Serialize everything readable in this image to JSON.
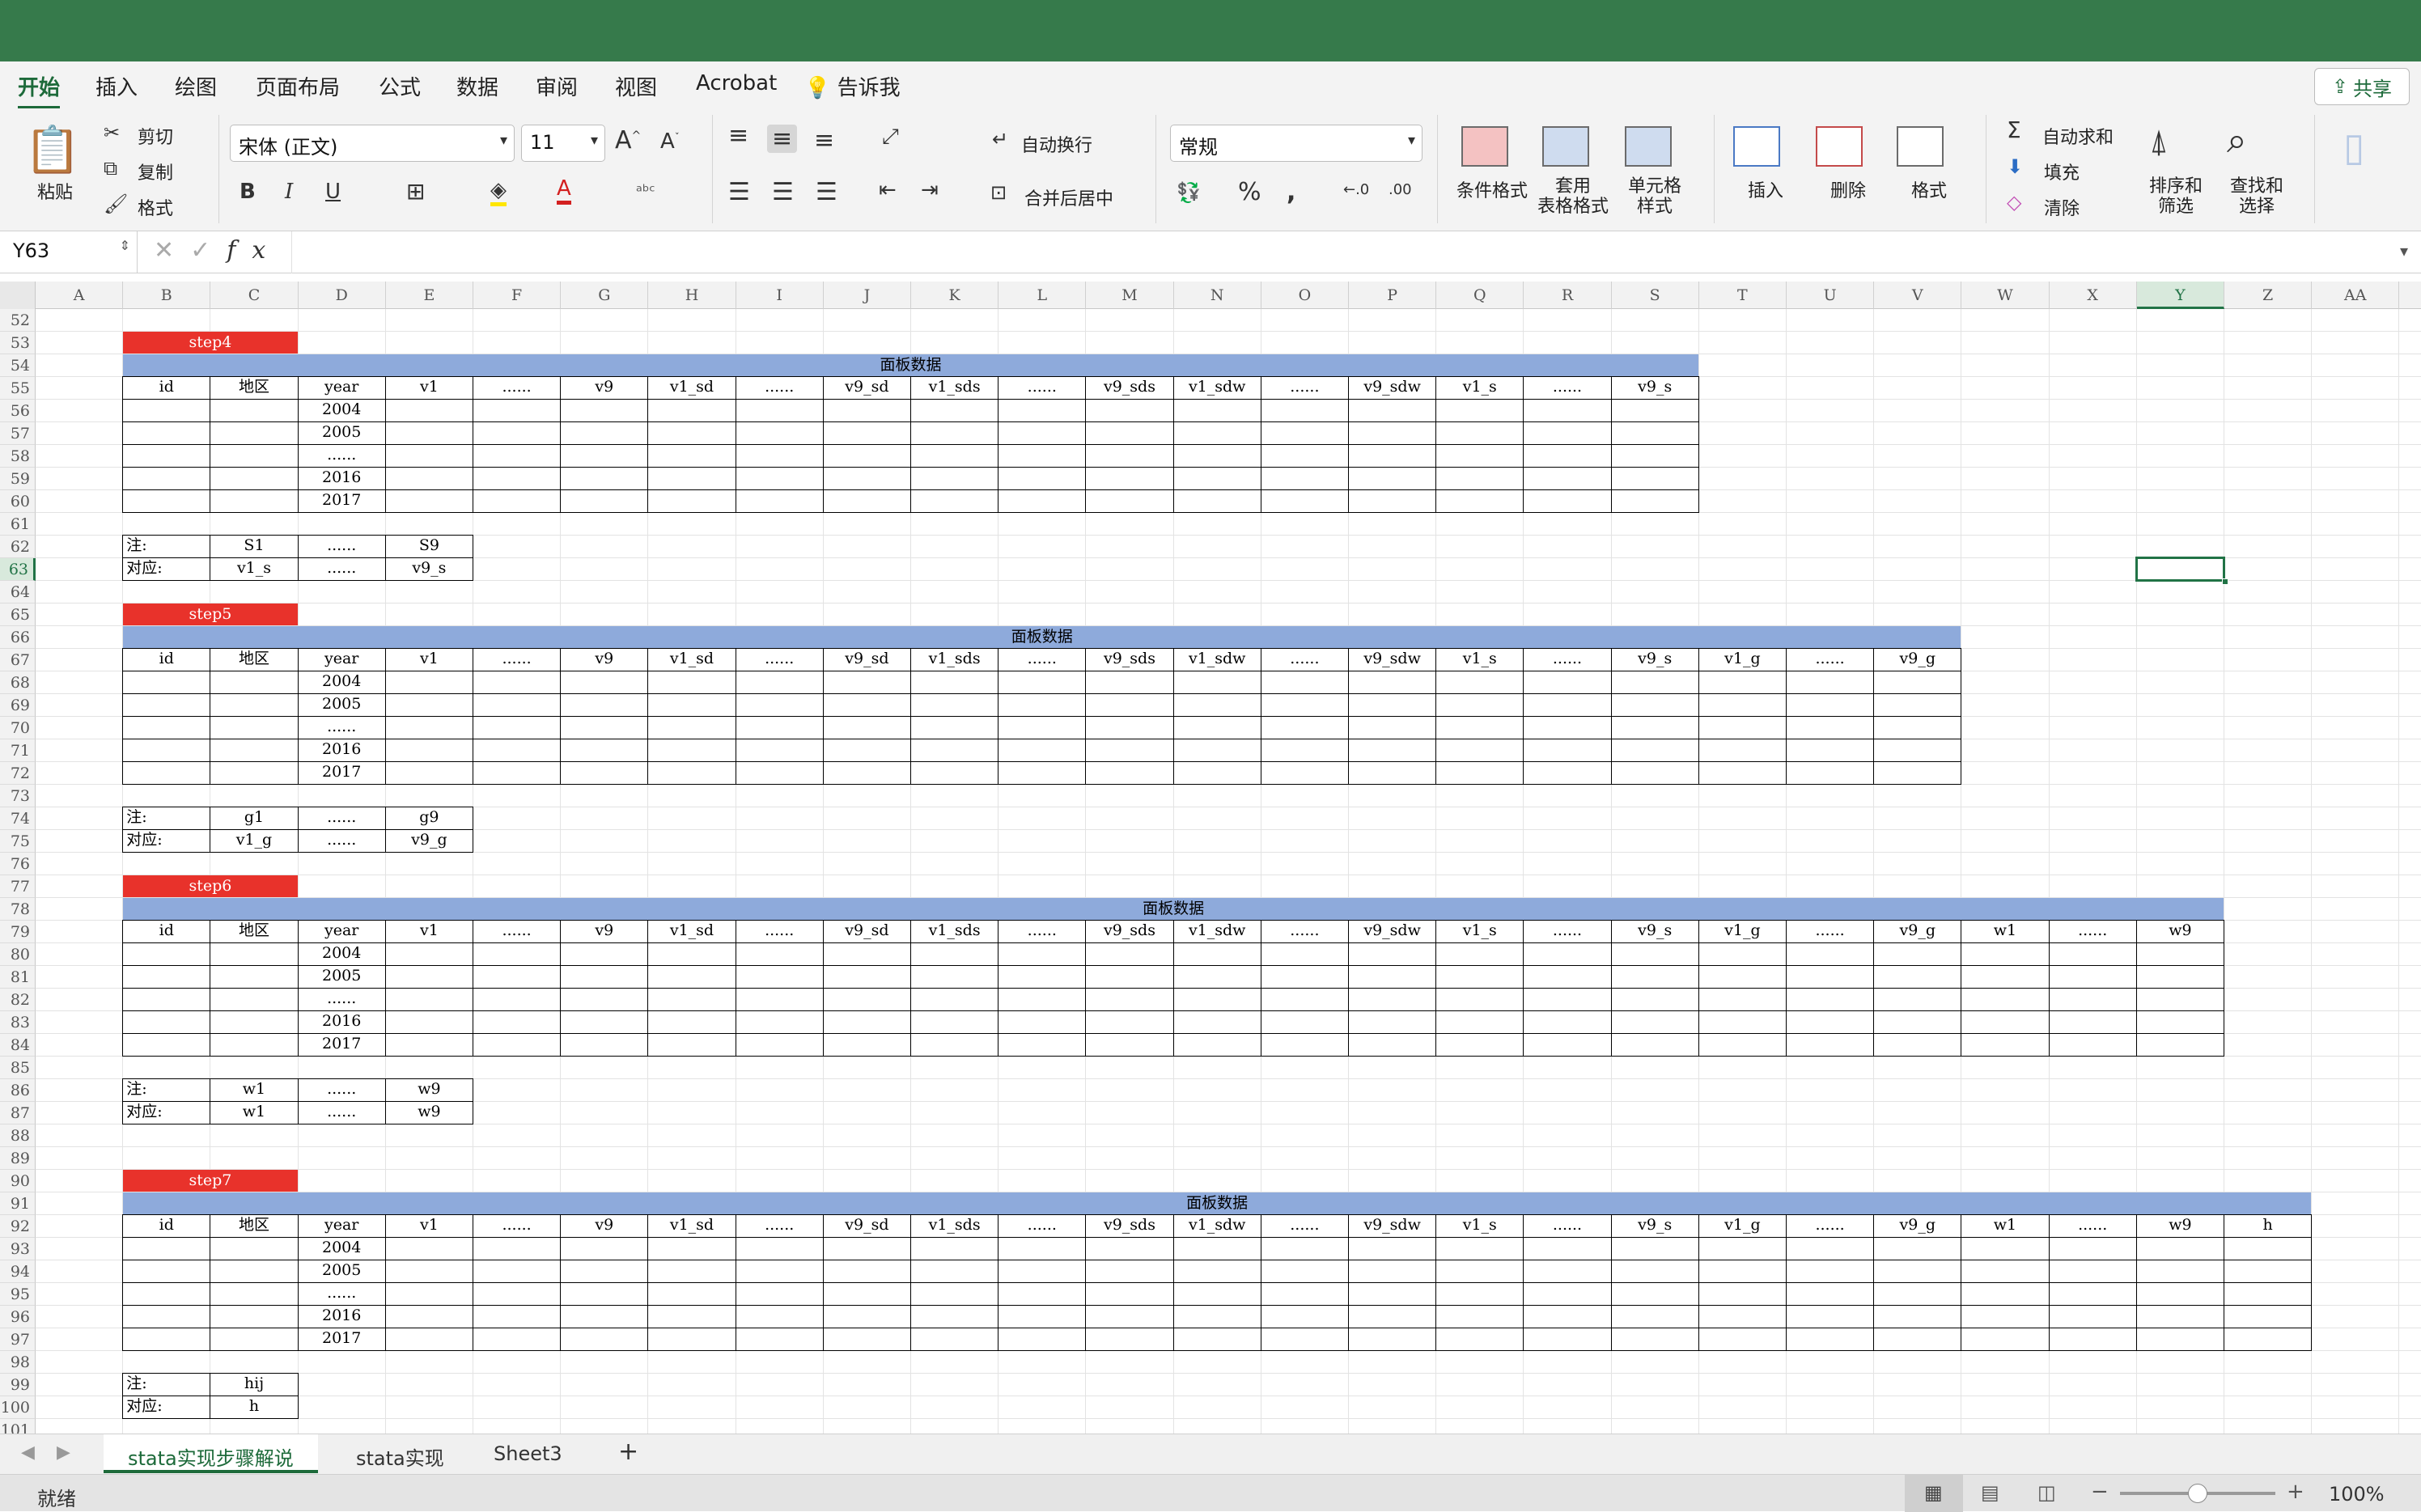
{
  "ribbon_tabs": [
    "开始",
    "插入",
    "绘图",
    "页面布局",
    "公式",
    "数据",
    "审阅",
    "视图",
    "Acrobat",
    "告诉我"
  ],
  "share_label": "共享",
  "clipboard": {
    "paste": "粘贴",
    "cut": "剪切",
    "copy": "复制",
    "format_painter": "格式"
  },
  "font": {
    "name": "宋体 (正文)",
    "size": "11",
    "bold": "B",
    "italic": "I",
    "underline": "U"
  },
  "alignment": {
    "wrap": "自动换行",
    "merge": "合并后居中"
  },
  "number": {
    "format": "常规",
    "percent": "%"
  },
  "styles": {
    "conditional": "条件格式",
    "table_format": "套用\n表格格式",
    "cell_style": "单元格\n样式"
  },
  "cells": {
    "insert": "插入",
    "delete": "删除",
    "format": "格式"
  },
  "editing": {
    "autosum": "自动求和",
    "fill": "填充",
    "clear": "清除",
    "sort": "排序和\n筛选",
    "find": "查找和\n选择"
  },
  "name_box": "Y63",
  "fx": "fx",
  "columns": [
    "A",
    "B",
    "C",
    "D",
    "E",
    "F",
    "G",
    "H",
    "I",
    "J",
    "K",
    "L",
    "M",
    "N",
    "O",
    "P",
    "Q",
    "R",
    "S",
    "T",
    "U",
    "V",
    "W",
    "X",
    "Y",
    "Z",
    "AA"
  ],
  "selected_cell": {
    "col": "Y",
    "row": 63
  },
  "first_row": 52,
  "last_row": 101,
  "sections": [
    {
      "step_row": 53,
      "step_label": "step4",
      "panel_row": 54,
      "panel_title": "面板数据",
      "header_row": 55,
      "headers": [
        "id",
        "地区",
        "year",
        "v1",
        "......",
        "v9",
        "v1_sd",
        "......",
        "v9_sd",
        "v1_sds",
        "......",
        "v9_sds",
        "v1_sdw",
        "......",
        "v9_sdw",
        "v1_s",
        "......",
        "v9_s"
      ],
      "years": [
        "2004",
        "2005",
        "......",
        "2016",
        "2017"
      ],
      "notes": [
        {
          "row": 62,
          "cells": [
            "注:",
            "S1",
            "......",
            "S9"
          ]
        },
        {
          "row": 63,
          "cells": [
            "对应:",
            "v1_s",
            "......",
            "v9_s"
          ]
        }
      ]
    },
    {
      "step_row": 65,
      "step_label": "step5",
      "panel_row": 66,
      "panel_title": "面板数据",
      "header_row": 67,
      "headers": [
        "id",
        "地区",
        "year",
        "v1",
        "......",
        "v9",
        "v1_sd",
        "......",
        "v9_sd",
        "v1_sds",
        "......",
        "v9_sds",
        "v1_sdw",
        "......",
        "v9_sdw",
        "v1_s",
        "......",
        "v9_s",
        "v1_g",
        "......",
        "v9_g"
      ],
      "years": [
        "2004",
        "2005",
        "......",
        "2016",
        "2017"
      ],
      "notes": [
        {
          "row": 74,
          "cells": [
            "注:",
            "g1",
            "......",
            "g9"
          ]
        },
        {
          "row": 75,
          "cells": [
            "对应:",
            "v1_g",
            "......",
            "v9_g"
          ]
        }
      ]
    },
    {
      "step_row": 77,
      "step_label": "step6",
      "panel_row": 78,
      "panel_title": "面板数据",
      "header_row": 79,
      "headers": [
        "id",
        "地区",
        "year",
        "v1",
        "......",
        "v9",
        "v1_sd",
        "......",
        "v9_sd",
        "v1_sds",
        "......",
        "v9_sds",
        "v1_sdw",
        "......",
        "v9_sdw",
        "v1_s",
        "......",
        "v9_s",
        "v1_g",
        "......",
        "v9_g",
        "w1",
        "......",
        "w9"
      ],
      "years": [
        "2004",
        "2005",
        "......",
        "2016",
        "2017"
      ],
      "notes": [
        {
          "row": 86,
          "cells": [
            "注:",
            "w1",
            "......",
            "w9"
          ]
        },
        {
          "row": 87,
          "cells": [
            "对应:",
            "w1",
            "......",
            "w9"
          ]
        }
      ]
    },
    {
      "step_row": 90,
      "step_label": "step7",
      "panel_row": 91,
      "panel_title": "面板数据",
      "header_row": 92,
      "headers": [
        "id",
        "地区",
        "year",
        "v1",
        "......",
        "v9",
        "v1_sd",
        "......",
        "v9_sd",
        "v1_sds",
        "......",
        "v9_sds",
        "v1_sdw",
        "......",
        "v9_sdw",
        "v1_s",
        "......",
        "v9_s",
        "v1_g",
        "......",
        "v9_g",
        "w1",
        "......",
        "w9",
        "h"
      ],
      "years": [
        "2004",
        "2005",
        "......",
        "2016",
        "2017"
      ],
      "notes": [
        {
          "row": 99,
          "cells": [
            "注:",
            "hij"
          ]
        },
        {
          "row": 100,
          "cells": [
            "对应:",
            "h"
          ]
        }
      ]
    }
  ],
  "sheet_tabs": [
    "stata实现步骤解说",
    "stata实现",
    "Sheet3"
  ],
  "active_sheet": 0,
  "status": "就绪",
  "zoom": "100%",
  "colors": {
    "title_bar": "#367a4b",
    "step_fill": "#e8322b",
    "panel_fill": "#8eaadb",
    "selection": "#217346"
  }
}
